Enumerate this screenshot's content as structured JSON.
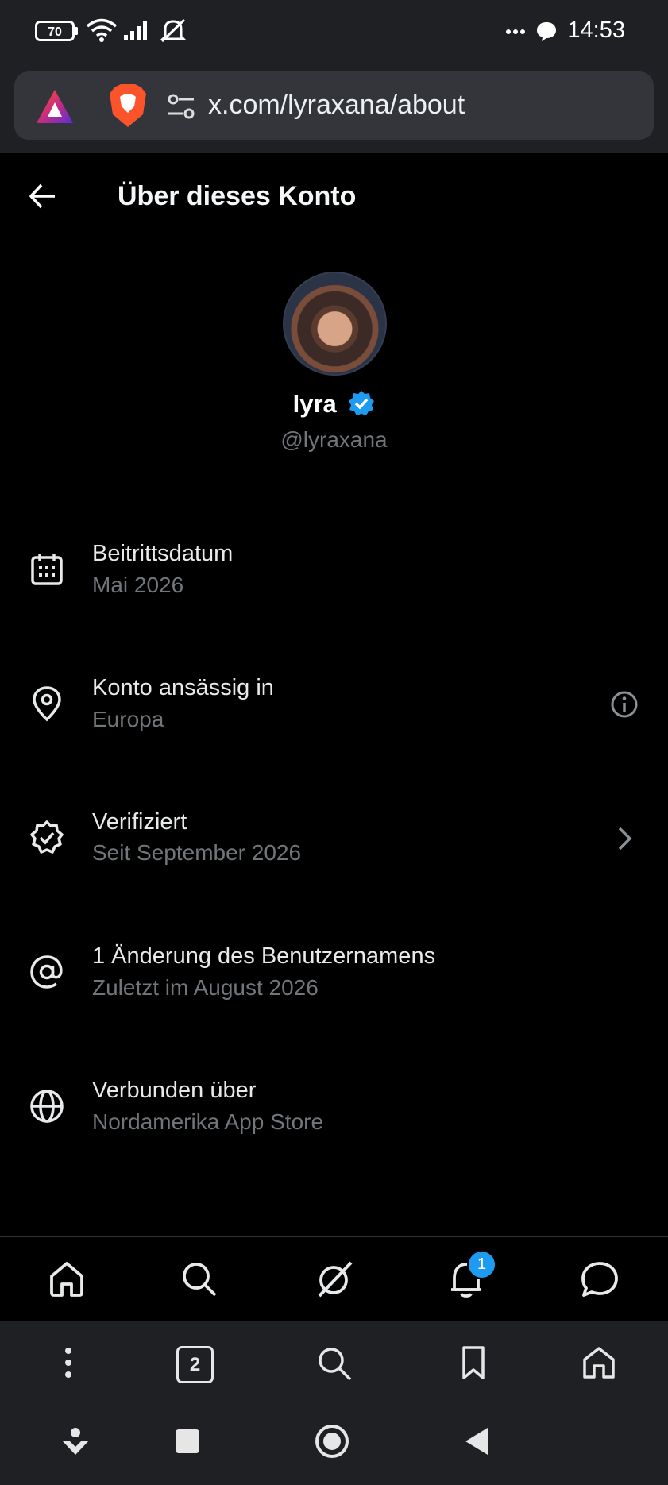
{
  "status_bar": {
    "battery": "70",
    "time": "14:53"
  },
  "browser": {
    "url": "x.com/lyraxana/about",
    "tab_count": "2"
  },
  "header": {
    "title": "Über dieses Konto"
  },
  "profile": {
    "name": "lyra",
    "handle": "@lyraxana"
  },
  "rows": [
    {
      "title": "Beitrittsdatum",
      "subtitle": "Mai 2026",
      "icon": "calendar-icon"
    },
    {
      "title": "Konto ansässig in",
      "subtitle": "Europa",
      "icon": "location-pin-icon",
      "trailing": "info-icon"
    },
    {
      "title": "Verifiziert",
      "subtitle": "Seit September 2026",
      "icon": "verified-badge-icon",
      "trailing": "chevron-right-icon"
    },
    {
      "title": "1 Änderung des Benutzernamens",
      "subtitle": "Zuletzt im August 2026",
      "icon": "at-sign-icon"
    },
    {
      "title": "Verbunden über",
      "subtitle": "Nordamerika App Store",
      "icon": "globe-icon"
    }
  ],
  "bottom_nav": {
    "items": [
      "home-icon",
      "search-icon",
      "grok-icon",
      "notifications-icon",
      "messages-icon"
    ],
    "notification_badge": "1"
  },
  "colors": {
    "background": "#000000",
    "accent": "#1d9bf0",
    "muted_text": "#71767b"
  }
}
